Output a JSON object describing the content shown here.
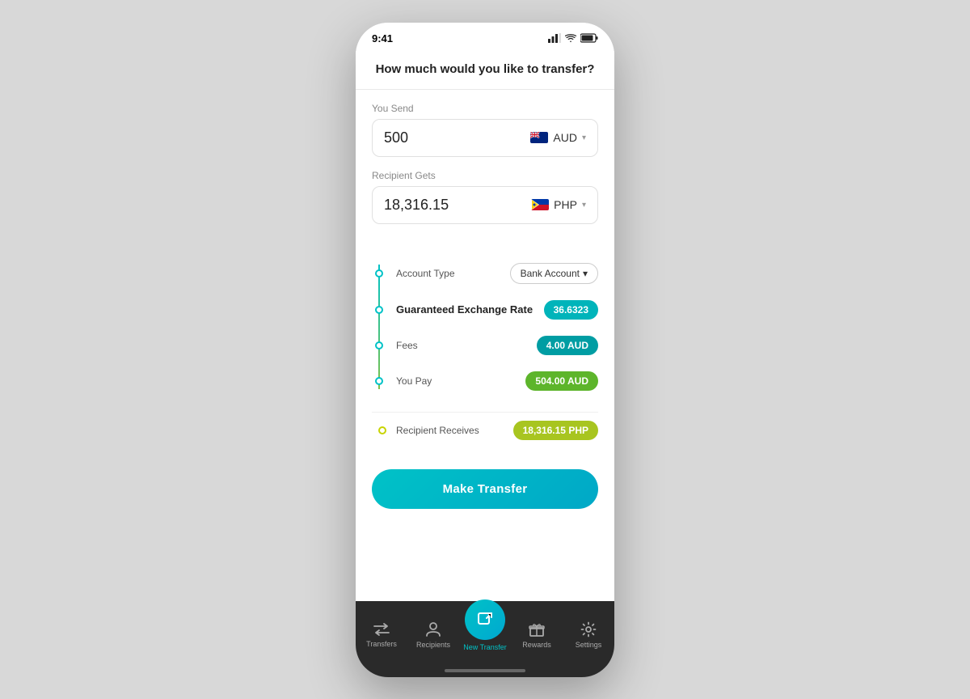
{
  "status_bar": {
    "time": "9:41",
    "signal": "▐▐▐",
    "wifi": "WiFi",
    "battery": "🔋"
  },
  "page": {
    "title": "How much would you like to transfer?"
  },
  "send": {
    "label": "You Send",
    "amount": "500",
    "currency": "AUD",
    "currency_flag": "AU"
  },
  "receive": {
    "label": "Recipient Gets",
    "amount": "18,316.15",
    "currency": "PHP",
    "currency_flag": "PH"
  },
  "details": {
    "account_type_label": "Account Type",
    "account_type_value": "Bank Account",
    "exchange_rate_label": "Guaranteed Exchange Rate",
    "exchange_rate_value": "36.6323",
    "fees_label": "Fees",
    "fees_value": "4.00 AUD",
    "you_pay_label": "You Pay",
    "you_pay_value": "504.00 AUD",
    "recipient_receives_label": "Recipient Receives",
    "recipient_receives_value": "18,316.15 PHP"
  },
  "button": {
    "make_transfer": "Make Transfer"
  },
  "nav": {
    "transfers": "Transfers",
    "recipients": "Recipients",
    "new_transfer": "New Transfer",
    "rewards": "Rewards",
    "settings": "Settings"
  },
  "colors": {
    "teal": "#00b8be",
    "green": "#5db52b",
    "yellow_green": "#a8c520",
    "dark_teal": "#009da3"
  }
}
